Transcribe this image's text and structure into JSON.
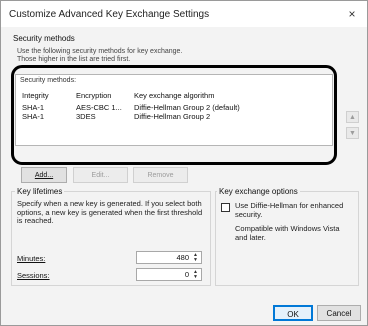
{
  "window": {
    "title": "Customize Advanced Key Exchange Settings",
    "close_symbol": "×"
  },
  "security_methods": {
    "group_title": "Security methods",
    "description_line1": "Use the following security methods for key exchange.",
    "description_line2": "Those higher in the list are tried first.",
    "list_title": "Security methods:",
    "columns": [
      "Integrity",
      "Encryption",
      "Key exchange algorithm"
    ],
    "rows": [
      {
        "integrity": "SHA-1",
        "encryption": "AES-CBC 1...",
        "algorithm": "Diffie-Hellman Group 2 (default)"
      },
      {
        "integrity": "SHA-1",
        "encryption": "3DES",
        "algorithm": "Diffie-Hellman Group 2"
      }
    ],
    "buttons": {
      "add": "Add...",
      "edit": "Edit...",
      "remove": "Remove"
    },
    "move_up_symbol": "▲",
    "move_down_symbol": "▼"
  },
  "key_lifetimes": {
    "group_title": "Key lifetimes",
    "description": "Specify when a new key is generated. If you select both options, a new key is generated when the first threshold is reached.",
    "minutes_label": "Minutes:",
    "minutes_value": "480",
    "sessions_label": "Sessions:",
    "sessions_value": "0"
  },
  "key_exchange_options": {
    "group_title": "Key exchange options",
    "checkbox_label": "Use Diffie-Hellman for enhanced security.",
    "checked": false,
    "compat_note": "Compatible with Windows Vista and later."
  },
  "footer": {
    "ok": "OK",
    "cancel": "Cancel"
  }
}
